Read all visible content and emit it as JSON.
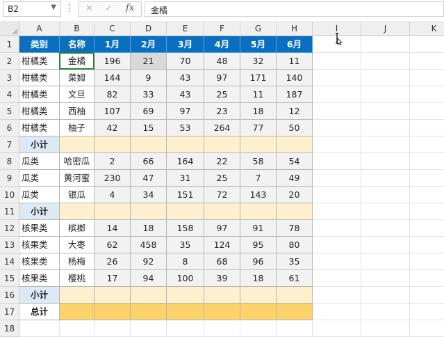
{
  "namebox": {
    "value": "B2"
  },
  "formula_bar": {
    "cancel": "✕",
    "confirm": "✓",
    "fx": "fx",
    "value": "金橘"
  },
  "columns": [
    "A",
    "B",
    "C",
    "D",
    "E",
    "F",
    "G",
    "H",
    "I",
    "J",
    "K"
  ],
  "rows": [
    "1",
    "2",
    "3",
    "4",
    "5",
    "6",
    "7",
    "8",
    "9",
    "10",
    "11",
    "12",
    "13",
    "14",
    "15",
    "16",
    "17",
    "18"
  ],
  "table": {
    "header": [
      "类别",
      "名称",
      "1月",
      "2月",
      "3月",
      "4月",
      "5月",
      "6月"
    ],
    "body": [
      {
        "type": "data",
        "cells": [
          "柑橘类",
          "金橘",
          "196",
          "21",
          "70",
          "48",
          "32",
          "11"
        ]
      },
      {
        "type": "data",
        "cells": [
          "柑橘类",
          "菜姆",
          "144",
          "9",
          "43",
          "97",
          "171",
          "140"
        ]
      },
      {
        "type": "data",
        "cells": [
          "柑橘类",
          "文旦",
          "82",
          "33",
          "43",
          "25",
          "11",
          "187"
        ]
      },
      {
        "type": "data",
        "cells": [
          "柑橘类",
          "西柚",
          "107",
          "69",
          "97",
          "23",
          "18",
          "12"
        ]
      },
      {
        "type": "data",
        "cells": [
          "柑橘类",
          "柚子",
          "42",
          "15",
          "53",
          "264",
          "77",
          "50"
        ]
      },
      {
        "type": "subtotal",
        "cells": [
          "小计",
          "",
          "",
          "",
          "",
          "",
          "",
          ""
        ]
      },
      {
        "type": "data",
        "cells": [
          "瓜类",
          "哈密瓜",
          "2",
          "66",
          "164",
          "22",
          "58",
          "54"
        ]
      },
      {
        "type": "data",
        "cells": [
          "瓜类",
          "黄河蜜",
          "230",
          "47",
          "31",
          "25",
          "7",
          "49"
        ]
      },
      {
        "type": "data",
        "cells": [
          "瓜类",
          "银瓜",
          "4",
          "34",
          "151",
          "72",
          "143",
          "20"
        ]
      },
      {
        "type": "subtotal",
        "cells": [
          "小计",
          "",
          "",
          "",
          "",
          "",
          "",
          ""
        ]
      },
      {
        "type": "data",
        "cells": [
          "核果类",
          "槟榔",
          "14",
          "18",
          "158",
          "97",
          "91",
          "78"
        ]
      },
      {
        "type": "data",
        "cells": [
          "核果类",
          "大枣",
          "62",
          "458",
          "35",
          "124",
          "95",
          "80"
        ]
      },
      {
        "type": "data",
        "cells": [
          "核果类",
          "杨梅",
          "26",
          "92",
          "8",
          "68",
          "96",
          "35"
        ]
      },
      {
        "type": "data",
        "cells": [
          "核果类",
          "樱桃",
          "17",
          "94",
          "100",
          "39",
          "18",
          "61"
        ]
      },
      {
        "type": "subtotal",
        "cells": [
          "小计",
          "",
          "",
          "",
          "",
          "",
          "",
          ""
        ]
      },
      {
        "type": "total",
        "cells": [
          "总计",
          "",
          "",
          "",
          "",
          "",
          "",
          ""
        ]
      }
    ]
  },
  "selected_cell": "B2",
  "colors": {
    "header": "#0b6fc1",
    "subtotal_label": "#ddeaf6",
    "subtotal": "#fcf0cf",
    "total": "#fcd26b",
    "selection": "#2b7a38"
  }
}
